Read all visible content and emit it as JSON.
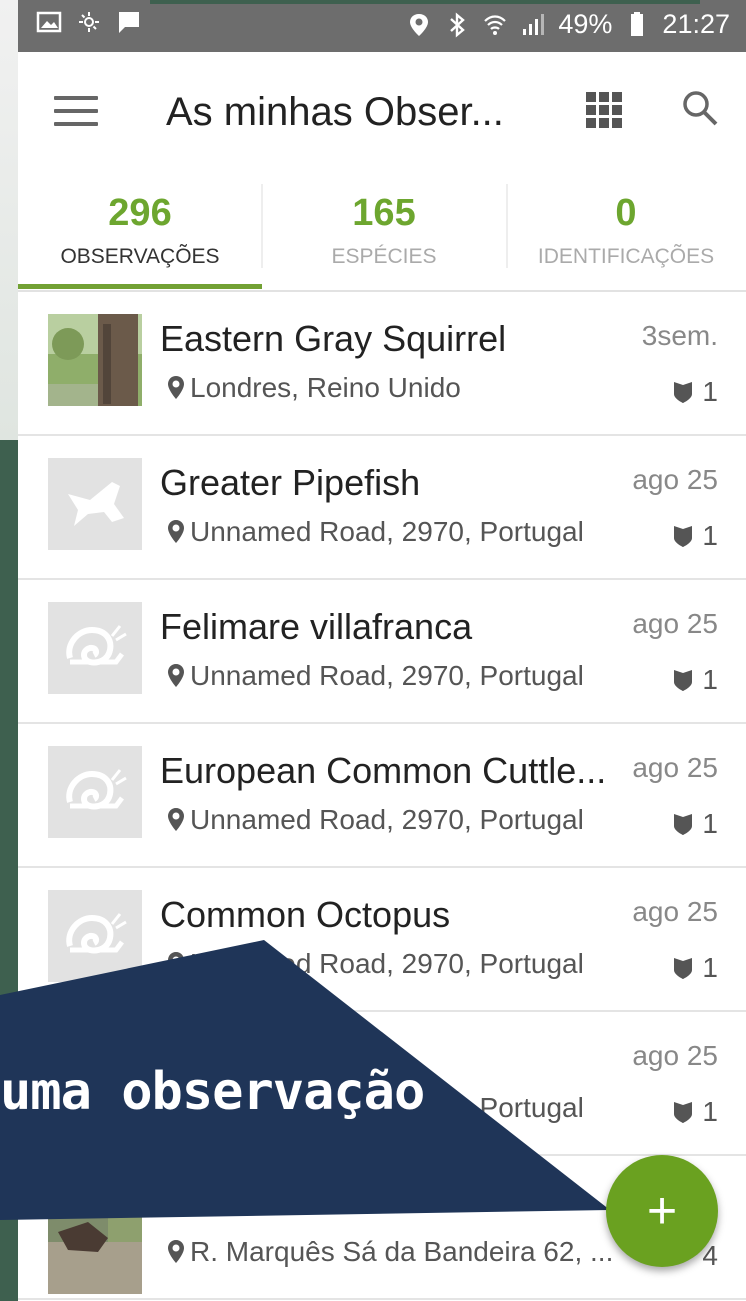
{
  "status_bar": {
    "battery": "49%",
    "time": "21:27"
  },
  "toolbar": {
    "title": "As minhas Obser..."
  },
  "tabs": [
    {
      "count": "296",
      "label": "OBSERVAÇÕES"
    },
    {
      "count": "165",
      "label": "ESPÉCIES"
    },
    {
      "count": "0",
      "label": "IDENTIFICAÇÕES"
    }
  ],
  "observations": [
    {
      "name": "Eastern Gray Squirrel",
      "place": "Londres, Reino Unido",
      "date": "3sem.",
      "ids": "1",
      "thumb": "photo"
    },
    {
      "name": "Greater Pipefish",
      "place": "Unnamed Road, 2970, Portugal",
      "date": "ago 25",
      "ids": "1",
      "thumb": "fish-icon"
    },
    {
      "name": "Felimare villafranca",
      "place": "Unnamed Road, 2970, Portugal",
      "date": "ago 25",
      "ids": "1",
      "thumb": "mollusk-icon"
    },
    {
      "name": "European Common Cuttle...",
      "place": "Unnamed Road, 2970, Portugal",
      "date": "ago 25",
      "ids": "1",
      "thumb": "mollusk-icon"
    },
    {
      "name": "Common Octopus",
      "place": "Unnamed Road, 2970, Portugal",
      "date": "ago 25",
      "ids": "1",
      "thumb": "mollusk-icon"
    },
    {
      "name": "",
      "place": "Unnamed Road, 2970, Portugal",
      "date": "ago 25",
      "ids": "1",
      "thumb": "none"
    },
    {
      "name": "",
      "place": "R. Marquês Sá da Bandeira 62, ...",
      "date": "",
      "ids": "4",
      "thumb": "photo"
    }
  ],
  "overlay": {
    "text": "uma observação"
  },
  "fab": {
    "icon": "+"
  },
  "colors": {
    "accent": "#6da62f",
    "fab": "#6aa120",
    "banner": "#1f3558",
    "status_bar": "#6d6d6d"
  }
}
